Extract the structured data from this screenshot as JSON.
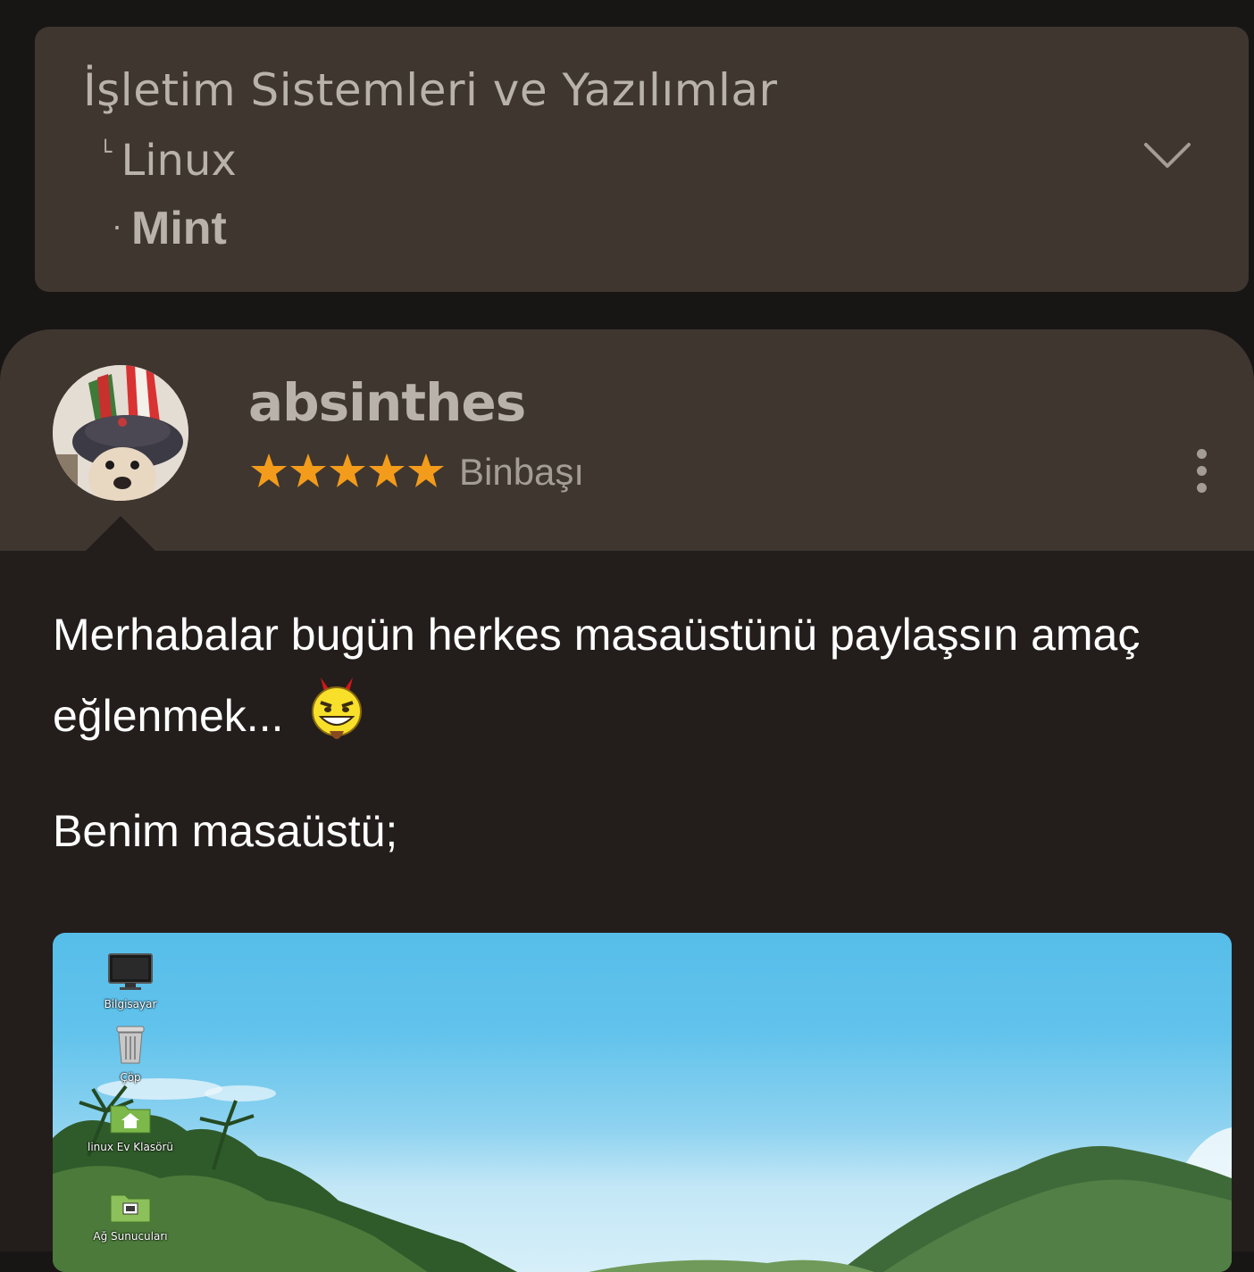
{
  "breadcrumb": {
    "category": "İşletim Sistemleri ve Yazılımlar",
    "subcategory": "Linux",
    "current": "Mint",
    "expand_icon": "chevron-down-icon"
  },
  "post": {
    "author": {
      "username": "absinthes",
      "rank": "Binbaşı",
      "stars": 5,
      "star_color": "#f39c1b"
    },
    "paragraphs": [
      "Merhabalar bugün herkes masaüstünü paylaşsın amaç eğlenmek...",
      "Benim masaüstü;"
    ],
    "emoji": "devil-smiley-icon",
    "desktop_screenshot": {
      "icons": [
        {
          "label": "Bilgisayar",
          "icon": "monitor-icon"
        },
        {
          "label": "Çöp",
          "icon": "trash-icon"
        },
        {
          "label": "linux Ev Klasörü",
          "icon": "home-folder-icon"
        },
        {
          "label": "Ağ Sunucuları",
          "icon": "network-folder-icon"
        }
      ]
    }
  },
  "colors": {
    "page_bg": "#181615",
    "card_bg": "#3f3630",
    "body_bg": "#231e1c",
    "muted_text": "#b8b2ab"
  }
}
